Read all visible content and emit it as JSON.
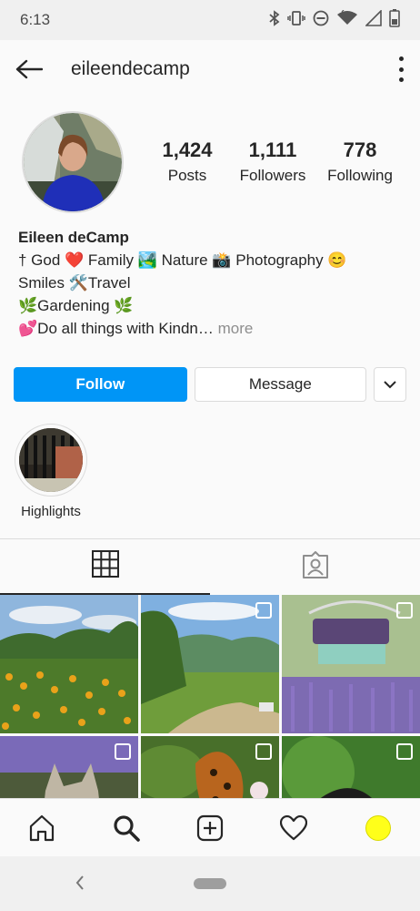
{
  "status_bar": {
    "time": "6:13",
    "icons": [
      "bluetooth-icon",
      "vibrate-icon",
      "dnd-icon",
      "wifi-icon",
      "signal-icon",
      "battery-icon"
    ]
  },
  "header": {
    "username": "eileendecamp",
    "back_icon": "arrow-left-icon",
    "menu_icon": "kebab-icon"
  },
  "profile": {
    "stats": [
      {
        "value": "1,424",
        "label": "Posts"
      },
      {
        "value": "1,111",
        "label": "Followers"
      },
      {
        "value": "778",
        "label": "Following"
      }
    ],
    "name": "Eileen deCamp",
    "bio_lines": [
      "† God ❤️ Family 🏞️ Nature 📸 Photography 😊",
      "Smiles 🛠️Travel",
      "🌿Gardening 🌿",
      "💕Do all things with Kindn…"
    ],
    "more_label": "more"
  },
  "actions": {
    "follow_label": "Follow",
    "message_label": "Message"
  },
  "highlights": [
    {
      "label": "Highlights"
    }
  ],
  "tabs": [
    "grid-icon",
    "tagged-icon"
  ],
  "colors": {
    "accent": "#0095f6",
    "text": "#262626",
    "muted": "#8e8e8e",
    "profile_dot": "#ffff1a"
  }
}
